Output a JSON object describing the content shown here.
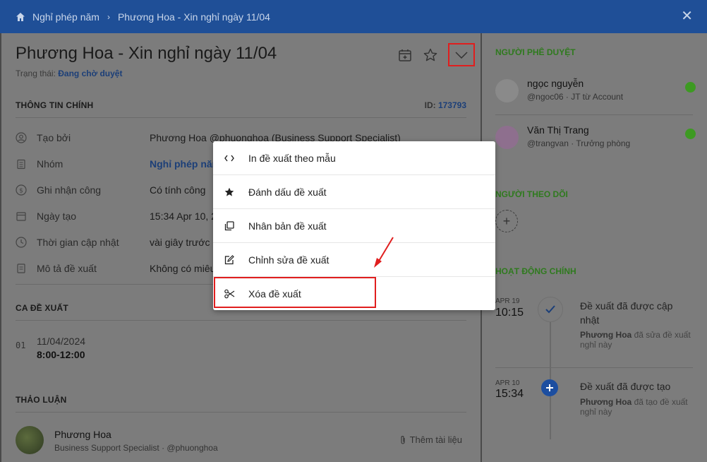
{
  "topbar": {
    "crumb_root": "Nghỉ phép năm",
    "crumb_current": "Phương Hoa - Xin nghỉ ngày 11/04"
  },
  "header": {
    "title": "Phương Hoa - Xin nghỉ ngày 11/04",
    "status_label": "Trạng thái:",
    "status_value": "Đang chờ duyệt"
  },
  "main_info": {
    "section_title": "THÔNG TIN CHÍNH",
    "id_label": "ID:",
    "id_value": "173793",
    "rows": [
      {
        "icon": "user-circle-icon",
        "label": "Tạo bởi",
        "value": "Phương Hoa @phuonghoa (Business Support Specialist)"
      },
      {
        "icon": "clipboard-icon",
        "label": "Nhóm",
        "value": "Nghỉ phép năm"
      },
      {
        "icon": "coin-icon",
        "label": "Ghi nhận công",
        "value": "Có tính công"
      },
      {
        "icon": "calendar-icon",
        "label": "Ngày tạo",
        "value": "15:34 Apr 10, 2"
      },
      {
        "icon": "clock-icon",
        "label": "Thời gian cập nhật",
        "value": "vài giây trước"
      },
      {
        "icon": "document-icon",
        "label": "Mô tả đề xuất",
        "value": "Không có miêu"
      }
    ]
  },
  "shifts": {
    "section_title": "CA ĐỀ XUẤT",
    "items": [
      {
        "no": "01",
        "date": "11/04/2024",
        "time": "8:00-12:00"
      }
    ]
  },
  "discussion": {
    "section_title": "THẢO LUẬN",
    "author": "Phương Hoa",
    "author_sub": "Business Support Specialist · @phuonghoa",
    "attach_label": "Thêm tài liệu"
  },
  "approvers": {
    "title": "NGƯỜI PHÊ DUYỆT",
    "items": [
      {
        "name": "ngọc nguyễn",
        "sub": "@ngoc06 · JT từ Account",
        "avatar_color": "#8a8a8a"
      },
      {
        "name": "Văn Thị Trang",
        "sub": "@trangvan · Trưởng phòng",
        "avatar_color": "#8e6f8e"
      }
    ],
    "status_color": "#3d9a22"
  },
  "followers": {
    "title": "NGƯỜI THEO DÕI"
  },
  "activity": {
    "title": "HOẠT ĐỘNG CHÍNH",
    "items": [
      {
        "date": "APR 19",
        "time": "10:15",
        "title": "Đề xuất đã được cập nhật",
        "actor": "Phương Hoa",
        "action": "đã sửa đề xuất nghỉ này"
      },
      {
        "date": "APR 10",
        "time": "15:34",
        "title": "Đề xuất đã được tạo",
        "actor": "Phương Hoa",
        "action": "đã tạo đề xuất nghỉ này"
      }
    ]
  },
  "menu": {
    "items": [
      {
        "icon": "code-icon",
        "label": "In đề xuất theo mẫu"
      },
      {
        "icon": "star-icon",
        "label": "Đánh dấu đề xuất"
      },
      {
        "icon": "copy-icon",
        "label": "Nhân bản đề xuất"
      },
      {
        "icon": "edit-icon",
        "label": "Chỉnh sửa đề xuất"
      },
      {
        "icon": "scissors-icon",
        "label": "Xóa đề xuất"
      }
    ]
  },
  "colors": {
    "topbar": "#1f4f97",
    "link": "#1c3f78",
    "section_green": "#2f7a1e",
    "highlight": "#e01e1e"
  }
}
